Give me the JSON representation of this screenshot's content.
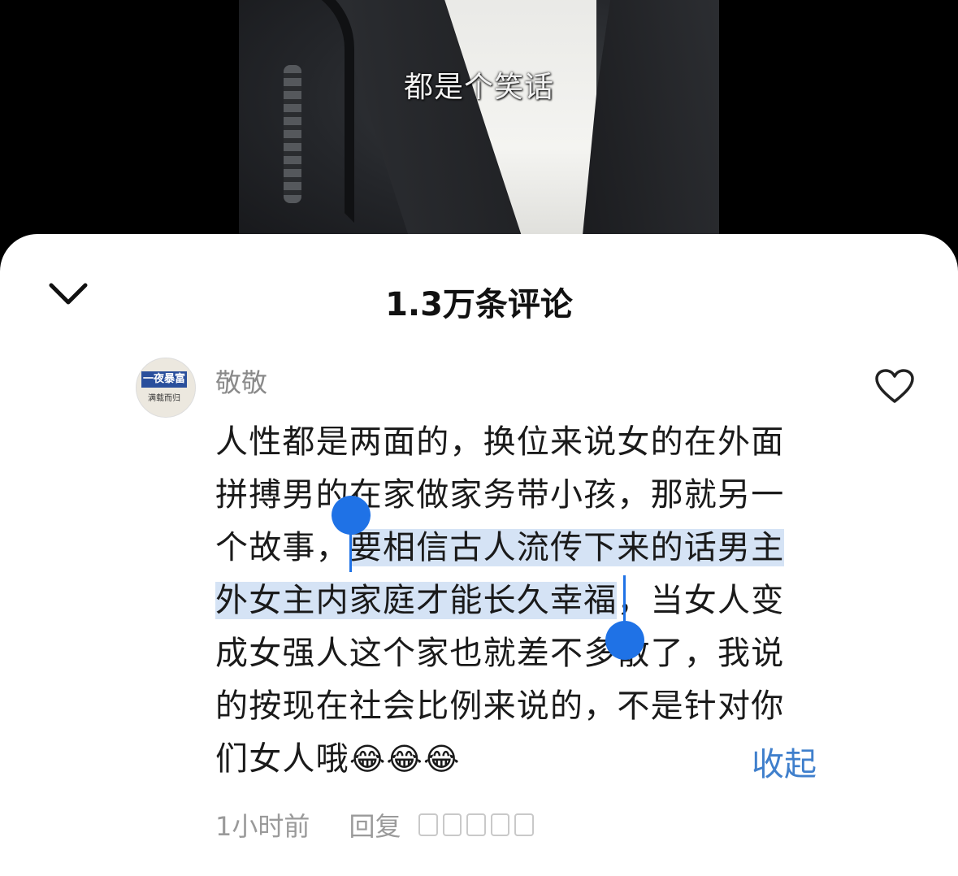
{
  "video": {
    "subtitle": "都是个笑话"
  },
  "sheet": {
    "title": "1.3万条评论",
    "collapse_icon": "chevron-down-icon"
  },
  "comment": {
    "username": "敬敬",
    "avatar_text": "一夜暴富",
    "avatar_subtext": "满载而归",
    "text_before": "人性都是两面的，换位来说女的在外面拼搏男的在家做家务带小孩，那就另一个故事，",
    "text_selected": "要相信古人流传下来的话男主外女主内家庭才能长久幸福",
    "text_after": "，当女人变成女强人这个家也就差不多散了，我说的按现在社会比例来说的，不是针对你们女人哦",
    "emojis": "😂😂😂",
    "collapse_label": "收起",
    "time": "1小时前",
    "reply_label": "回复",
    "like_icon": "heart-outline-icon",
    "selection_color": "#d5e3f5",
    "handle_color": "#1f72e6",
    "link_color": "#3f7fcc"
  }
}
